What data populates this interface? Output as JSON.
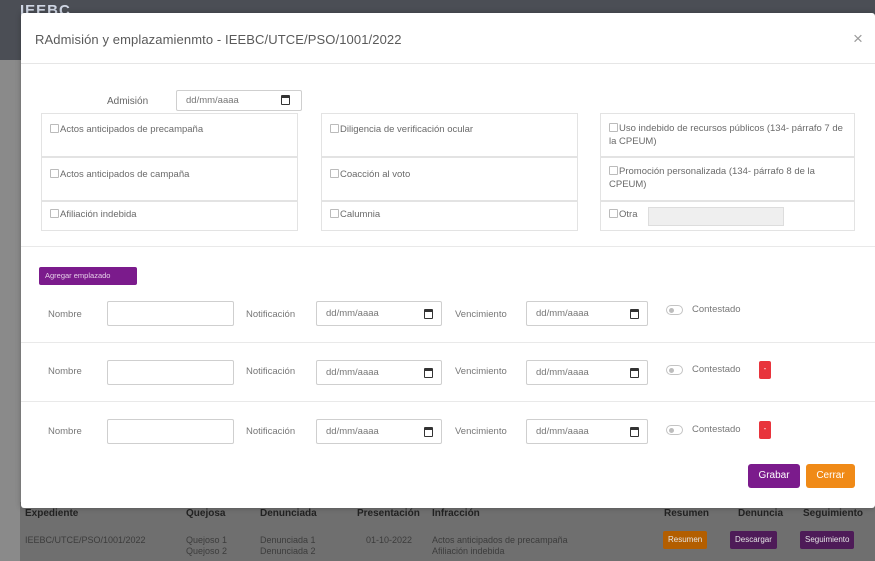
{
  "background": {
    "brand": "IEEBC",
    "table_headers": [
      "Expediente",
      "Quejosa",
      "Denunciada",
      "Presentación",
      "Infracción",
      "Resumen",
      "Denuncia",
      "Seguimiento"
    ],
    "row": {
      "expediente": "IEEBC/UTCE/PSO/1001/2022",
      "quejosa": [
        "Quejoso 1",
        "Quejoso 2"
      ],
      "denunciada": [
        "Denunciada 1",
        "Denunciada 2"
      ],
      "presentacion": "01-10-2022",
      "infraccion": [
        "Actos anticipados de precampaña",
        "Afiliación indebida"
      ],
      "buttons": [
        "Resumen",
        "Descargar",
        "Seguimiento"
      ]
    }
  },
  "modal": {
    "title": "RAdmisión y emplazamienmto - IEEBC/UTCE/PSO/1001/2022",
    "close_symbol": "×",
    "admision_label": "Admisión",
    "date_placeholder": "dd/mm/aaaa",
    "checkboxes": {
      "col1": [
        "Actos anticipados de precampaña",
        "Actos anticipados de campaña",
        "Afiliación indebida"
      ],
      "col2": [
        "Diligencia de verificación ocular",
        "Coacción al voto",
        "Calumnia"
      ],
      "col3": [
        "Uso indebido de recursos públicos (134- párrafo 7 de la CPEUM)",
        "Promoción personalizada (134- párrafo 8 de la CPEUM)",
        "Otra"
      ]
    },
    "add_button": "Agregar emplazado",
    "rows_labels": {
      "nombre": "Nombre",
      "notificacion": "Notificación",
      "vencimiento": "Vencimiento",
      "contestado": "Contestado"
    },
    "delete_symbol": "-",
    "grabar": "Grabar",
    "cerrar": "Cerrar"
  },
  "colors": {
    "purple": "#7b1b8c",
    "orange": "#f08a17",
    "red": "#e8343c"
  }
}
